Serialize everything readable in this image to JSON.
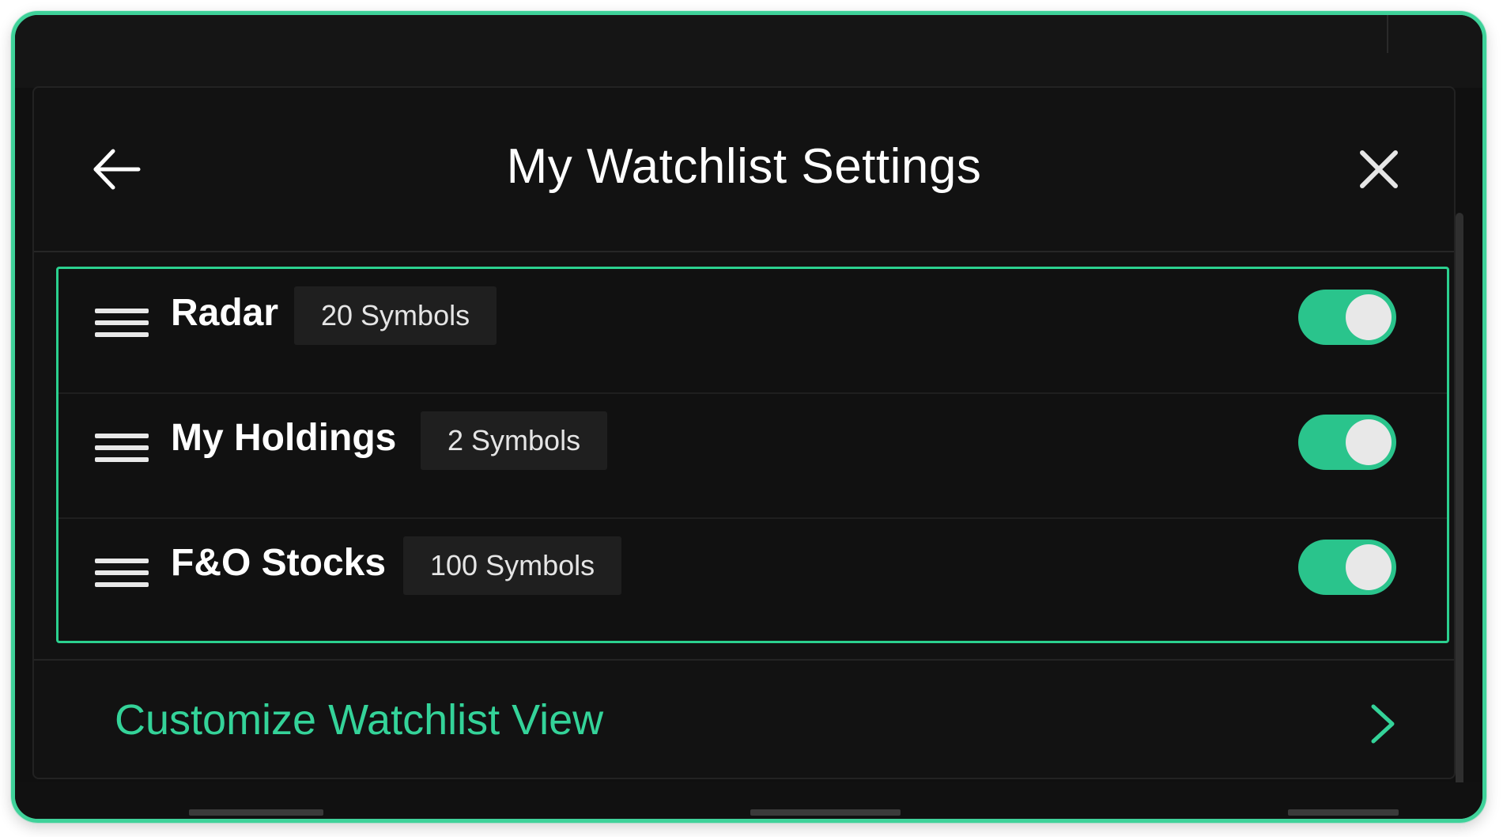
{
  "panel": {
    "title": "My Watchlist Settings",
    "back_icon": "arrow-left-icon",
    "close_icon": "close-icon"
  },
  "watchlists": [
    {
      "name": "Radar",
      "badge": "20 Symbols",
      "enabled": true
    },
    {
      "name": "My Holdings",
      "badge": "2 Symbols",
      "enabled": true
    },
    {
      "name": "F&O Stocks",
      "badge": "100 Symbols",
      "enabled": true
    }
  ],
  "customize": {
    "label": "Customize Watchlist View",
    "icon": "chevron-right-icon"
  },
  "colors": {
    "accent": "#2bd08f",
    "toggle_on": "#2ac48c",
    "link_text": "#34d399",
    "background": "#121212"
  }
}
